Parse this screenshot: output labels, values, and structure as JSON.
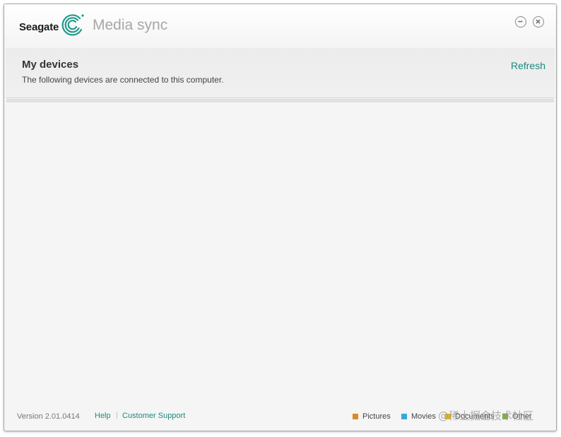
{
  "app": {
    "brand": "Seagate",
    "name": "Media sync"
  },
  "header": {
    "title": "My devices",
    "subtitle": "The following devices are connected to this computer.",
    "refresh_label": "Refresh"
  },
  "footer": {
    "version": "Version 2.01.0414",
    "help_label": "Help",
    "separator": "|",
    "support_label": "Customer Support",
    "legend": [
      {
        "label": "Pictures",
        "color": "#d98a2b"
      },
      {
        "label": "Movies",
        "color": "#3aa7d6"
      },
      {
        "label": "Documents",
        "color": "#e6b21c"
      },
      {
        "label": "Other",
        "color": "#7cb342"
      }
    ]
  },
  "watermark": "@稀土掘金技术社区",
  "colors": {
    "accent": "#1a8a7d",
    "brand_mark": "#1e9a8c"
  },
  "icons": {
    "minimize": "minus-circle-icon",
    "close": "x-circle-icon",
    "logo": "seagate-spiral-logo"
  }
}
